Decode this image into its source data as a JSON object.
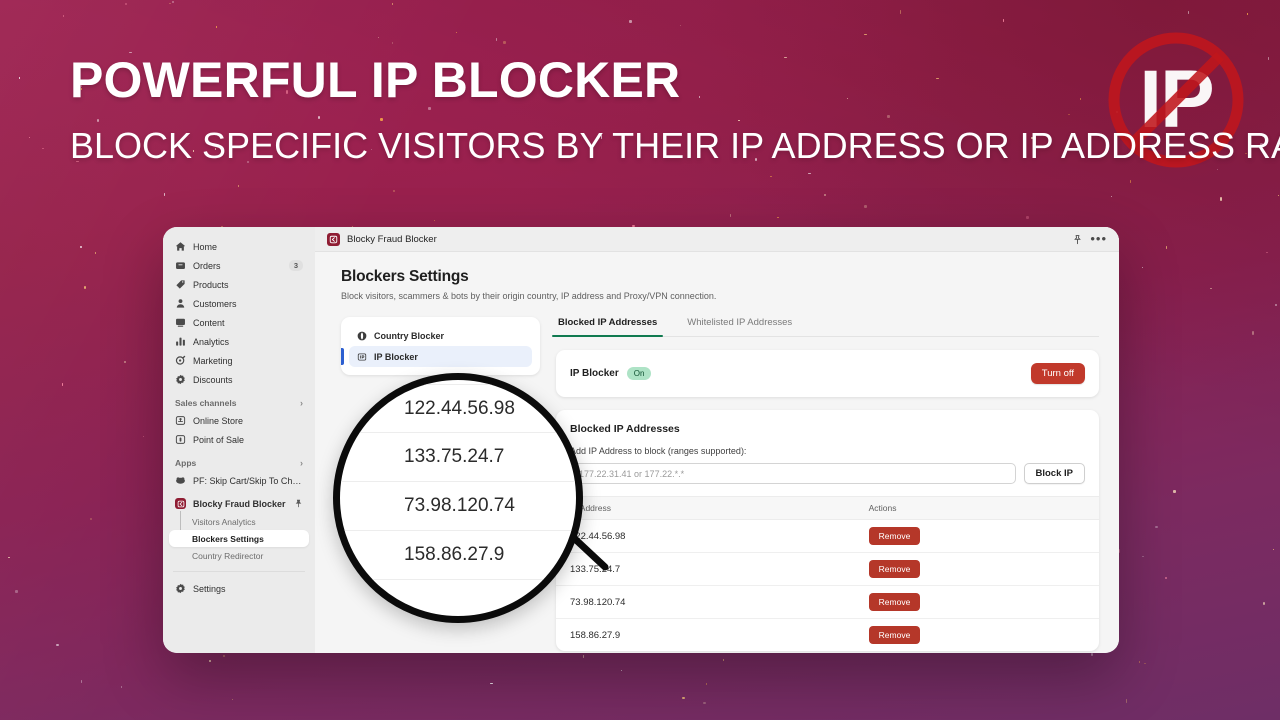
{
  "hero": {
    "title": "POWERFUL IP BLOCKER",
    "subtitle": "BLOCK SPECIFIC VISITORS BY THEIR IP ADDRESS OR IP ADDRESS RANGE",
    "logo_text": "IP",
    "logo_icon": "prohibition-sign-icon",
    "background_top_color": "#9d2150",
    "background_bottom_color": "#6e2e66",
    "logo_color": "#c0161c"
  },
  "sidebar": {
    "items": [
      {
        "label": "Home",
        "icon": "home-icon",
        "badge": ""
      },
      {
        "label": "Orders",
        "icon": "orders-icon",
        "badge": "3"
      },
      {
        "label": "Products",
        "icon": "products-tag-icon",
        "badge": ""
      },
      {
        "label": "Customers",
        "icon": "customers-person-icon",
        "badge": ""
      },
      {
        "label": "Content",
        "icon": "content-icon",
        "badge": ""
      },
      {
        "label": "Analytics",
        "icon": "analytics-bars-icon",
        "badge": ""
      },
      {
        "label": "Marketing",
        "icon": "marketing-target-icon",
        "badge": ""
      },
      {
        "label": "Discounts",
        "icon": "discounts-icon",
        "badge": ""
      }
    ],
    "sales_channels": {
      "label": "Sales channels",
      "chevron": "›",
      "items": [
        {
          "label": "Online Store",
          "icon": "online-store-icon"
        },
        {
          "label": "Point of Sale",
          "icon": "point-of-sale-icon"
        }
      ]
    },
    "apps": {
      "label": "Apps",
      "chevron": "›",
      "items": [
        {
          "label": "PF: Skip Cart/Skip To Che...",
          "icon": "app-generic-icon"
        }
      ]
    },
    "app_group": {
      "label": "Blocky Fraud Blocker",
      "icon": "blocky-app-icon",
      "pin_icon": "pin-icon",
      "children": [
        {
          "label": "Visitors Analytics",
          "selected": false
        },
        {
          "label": "Blockers Settings",
          "selected": true
        },
        {
          "label": "Country Redirector",
          "selected": false
        }
      ]
    },
    "settings": {
      "label": "Settings",
      "icon": "gear-icon"
    }
  },
  "app_window": {
    "topbar": {
      "title": "Blocky Fraud Blocker",
      "logo_icon": "blocky-app-icon",
      "pin_icon": "pin-icon",
      "more_icon": "more-horizontal-icon",
      "more_glyph": "•••"
    },
    "page_title": "Blockers Settings",
    "page_subtitle": "Block visitors, scammers & bots by their origin country, IP address and Proxy/VPN connection."
  },
  "blocker_nav": {
    "items": [
      {
        "label": "Country Blocker",
        "icon": "globe-icon",
        "active": false
      },
      {
        "label": "IP Blocker",
        "icon": "ip-card-icon",
        "active": true
      }
    ]
  },
  "tabs": [
    {
      "label": "Blocked IP Addresses",
      "active": true
    },
    {
      "label": "Whitelisted IP Addresses",
      "active": false
    }
  ],
  "toggle_card": {
    "name": "IP Blocker",
    "status": "On",
    "status_color": "#aee3c6",
    "button_label": "Turn off",
    "button_color": "#c1392b"
  },
  "list_card": {
    "title": "Blocked IP Addresses",
    "field_label": "Add IP Address to block (ranges supported):",
    "input_value": "",
    "input_placeholder": "177.22.31.41 or 177.22.*.*",
    "submit_label": "Block IP",
    "columns": [
      "IP Address",
      "Actions"
    ],
    "rows": [
      {
        "ip": "122.44.56.98",
        "action": "Remove"
      },
      {
        "ip": "133.75.24.7",
        "action": "Remove"
      },
      {
        "ip": "73.98.120.74",
        "action": "Remove"
      },
      {
        "ip": "158.86.27.9",
        "action": "Remove"
      }
    ]
  },
  "magnifier": {
    "icon": "magnifying-glass-icon",
    "rows": [
      "122.44.56.98",
      "133.75.24.7",
      "73.98.120.74",
      "158.86.27.9"
    ]
  }
}
